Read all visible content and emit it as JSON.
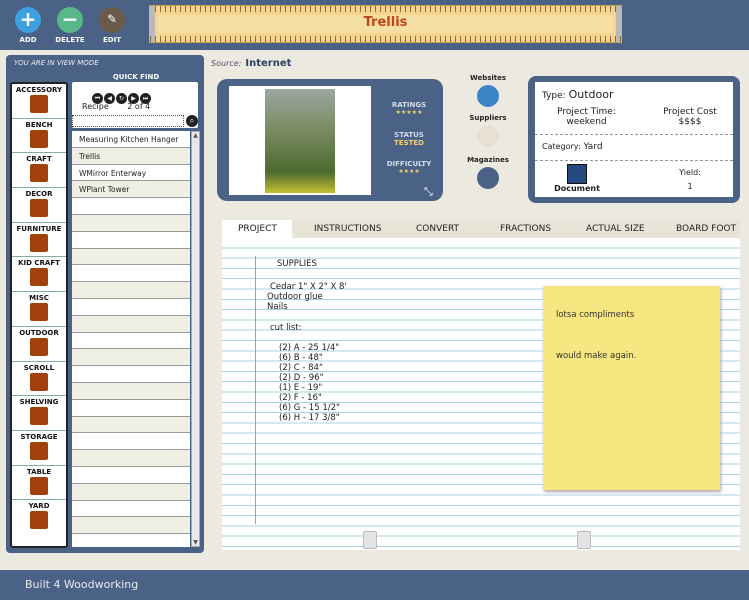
{
  "toolbar": {
    "add_label": "ADD",
    "delete_label": "DELETE",
    "edit_label": "EDIT",
    "title": "Trellis"
  },
  "left_panel": {
    "mode_text": "YOU ARE IN VIEW MODE",
    "quick_find_label": "QUICK FIND",
    "recipe_label": "Recipe",
    "recipe_position": "2 of 4",
    "categories": [
      "ACCESSORY",
      "BENCH",
      "CRAFT",
      "DECOR",
      "FURNITURE",
      "KID CRAFT",
      "MISC",
      "OUTDOOR",
      "SCROLL",
      "SHELVING",
      "STORAGE",
      "TABLE",
      "YARD"
    ],
    "recipes": [
      "Measuring Kitchen Hanger",
      "Trellis",
      "WMirror Enterway",
      "WPlant Tower",
      "",
      "",
      "",
      "",
      "",
      "",
      "",
      "",
      "",
      "",
      "",
      "",
      "",
      "",
      "",
      "",
      "",
      "",
      "",
      ""
    ]
  },
  "source": {
    "label": "Source:",
    "value": "Internet"
  },
  "stats": {
    "ratings_label": "RATINGS",
    "ratings_value": "★★★★★",
    "status_label": "STATUS",
    "status_value": "TESTED",
    "difficulty_label": "DIFFICULTY",
    "difficulty_value": "★★★★"
  },
  "links": {
    "websites": "Websites",
    "suppliers": "Suppliers",
    "magazines": "Magazines"
  },
  "info": {
    "type_label": "Type:",
    "type_value": "Outdoor",
    "project_time_label": "Project Time:",
    "project_time_value": "weekend",
    "project_cost_label": "Project Cost",
    "project_cost_value": "$$$$",
    "category_label": "Category:",
    "category_value": "Yard",
    "document_label": "Document",
    "yield_label": "Yield:",
    "yield_value": "1"
  },
  "tabs": [
    "PROJECT",
    "INSTRUCTIONS",
    "CONVERT",
    "FRACTIONS",
    "ACTUAL SIZE",
    "BOARD FOOT"
  ],
  "project": {
    "supplies_heading": "SUPPLIES",
    "supplies": [
      "Cedar 1\" X 2\" X 8'",
      "Outdoor glue",
      "Nails"
    ],
    "cut_list_heading": "cut list:",
    "cut_list": [
      "(2) A - 25 1/4\"",
      "(6) B - 48\"",
      "(2) C - 84\"",
      "(2) D - 96\"",
      "(1) E - 19\"",
      "(2) F - 16\"",
      "(6) G - 15 1/2\"",
      "(6) H - 17 3/8\""
    ]
  },
  "note": {
    "line1": "lotsa compliments",
    "line2": "would make again."
  },
  "brand": {
    "text": "Built 4 Woodworking"
  }
}
